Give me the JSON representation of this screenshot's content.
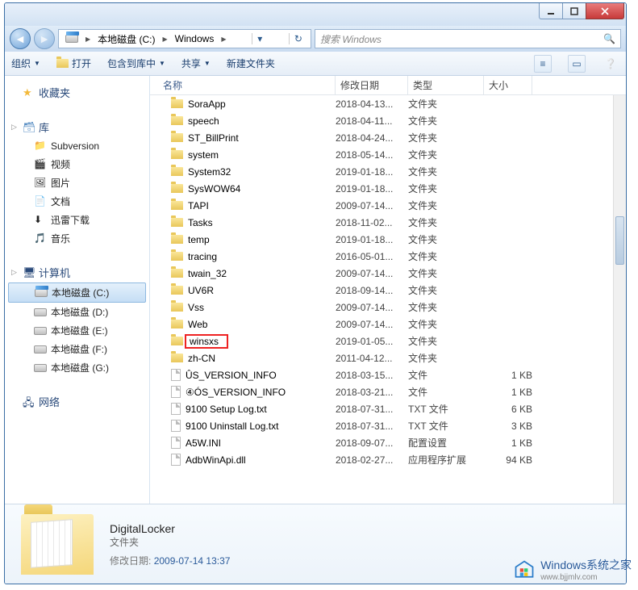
{
  "breadcrumb": {
    "drive": "本地磁盘 (C:)",
    "folder": "Windows"
  },
  "search": {
    "placeholder": "搜索 Windows"
  },
  "toolbar": {
    "organize": "组织",
    "open": "打开",
    "include": "包含到库中",
    "share": "共享",
    "newfolder": "新建文件夹"
  },
  "sidebar": {
    "favorites": "收藏夹",
    "libraries": "库",
    "lib_items": [
      "Subversion",
      "视频",
      "图片",
      "文档",
      "迅雷下载",
      "音乐"
    ],
    "computer": "计算机",
    "drives": [
      "本地磁盘 (C:)",
      "本地磁盘 (D:)",
      "本地磁盘 (E:)",
      "本地磁盘 (F:)",
      "本地磁盘 (G:)"
    ],
    "network": "网络"
  },
  "columns": {
    "name": "名称",
    "date": "修改日期",
    "type": "类型",
    "size": "大小"
  },
  "files": [
    {
      "n": "SoraApp",
      "d": "2018-04-13...",
      "t": "文件夹",
      "s": "",
      "k": "folder"
    },
    {
      "n": "speech",
      "d": "2018-04-11...",
      "t": "文件夹",
      "s": "",
      "k": "folder"
    },
    {
      "n": "ST_BillPrint",
      "d": "2018-04-24...",
      "t": "文件夹",
      "s": "",
      "k": "folder"
    },
    {
      "n": "system",
      "d": "2018-05-14...",
      "t": "文件夹",
      "s": "",
      "k": "folder"
    },
    {
      "n": "System32",
      "d": "2019-01-18...",
      "t": "文件夹",
      "s": "",
      "k": "folder"
    },
    {
      "n": "SysWOW64",
      "d": "2019-01-18...",
      "t": "文件夹",
      "s": "",
      "k": "folder"
    },
    {
      "n": "TAPI",
      "d": "2009-07-14...",
      "t": "文件夹",
      "s": "",
      "k": "folder"
    },
    {
      "n": "Tasks",
      "d": "2018-11-02...",
      "t": "文件夹",
      "s": "",
      "k": "folder"
    },
    {
      "n": "temp",
      "d": "2019-01-18...",
      "t": "文件夹",
      "s": "",
      "k": "folder"
    },
    {
      "n": "tracing",
      "d": "2016-05-01...",
      "t": "文件夹",
      "s": "",
      "k": "folder"
    },
    {
      "n": "twain_32",
      "d": "2009-07-14...",
      "t": "文件夹",
      "s": "",
      "k": "folder"
    },
    {
      "n": "UV6R",
      "d": "2018-09-14...",
      "t": "文件夹",
      "s": "",
      "k": "folder"
    },
    {
      "n": "Vss",
      "d": "2009-07-14...",
      "t": "文件夹",
      "s": "",
      "k": "folder"
    },
    {
      "n": "Web",
      "d": "2009-07-14...",
      "t": "文件夹",
      "s": "",
      "k": "folder"
    },
    {
      "n": "winsxs",
      "d": "2019-01-05...",
      "t": "文件夹",
      "s": "",
      "k": "folder",
      "hl": true
    },
    {
      "n": "zh-CN",
      "d": "2011-04-12...",
      "t": "文件夹",
      "s": "",
      "k": "folder"
    },
    {
      "n": "ÛS_VERSION_INFO",
      "d": "2018-03-15...",
      "t": "文件",
      "s": "1 KB",
      "k": "file"
    },
    {
      "n": "④ÓS_VERSION_INFO",
      "d": "2018-03-21...",
      "t": "文件",
      "s": "1 KB",
      "k": "file"
    },
    {
      "n": "9100 Setup Log.txt",
      "d": "2018-07-31...",
      "t": "TXT 文件",
      "s": "6 KB",
      "k": "file"
    },
    {
      "n": "9100 Uninstall Log.txt",
      "d": "2018-07-31...",
      "t": "TXT 文件",
      "s": "3 KB",
      "k": "file"
    },
    {
      "n": "A5W.INI",
      "d": "2018-09-07...",
      "t": "配置设置",
      "s": "1 KB",
      "k": "file"
    },
    {
      "n": "AdbWinApi.dll",
      "d": "2018-02-27...",
      "t": "应用程序扩展",
      "s": "94 KB",
      "k": "file"
    }
  ],
  "details": {
    "name": "DigitalLocker",
    "type": "文件夹",
    "date_label": "修改日期:",
    "date_value": "2009-07-14 13:37"
  },
  "watermark": {
    "title": "Windows系统之家",
    "url": "www.bjjmlv.com"
  }
}
